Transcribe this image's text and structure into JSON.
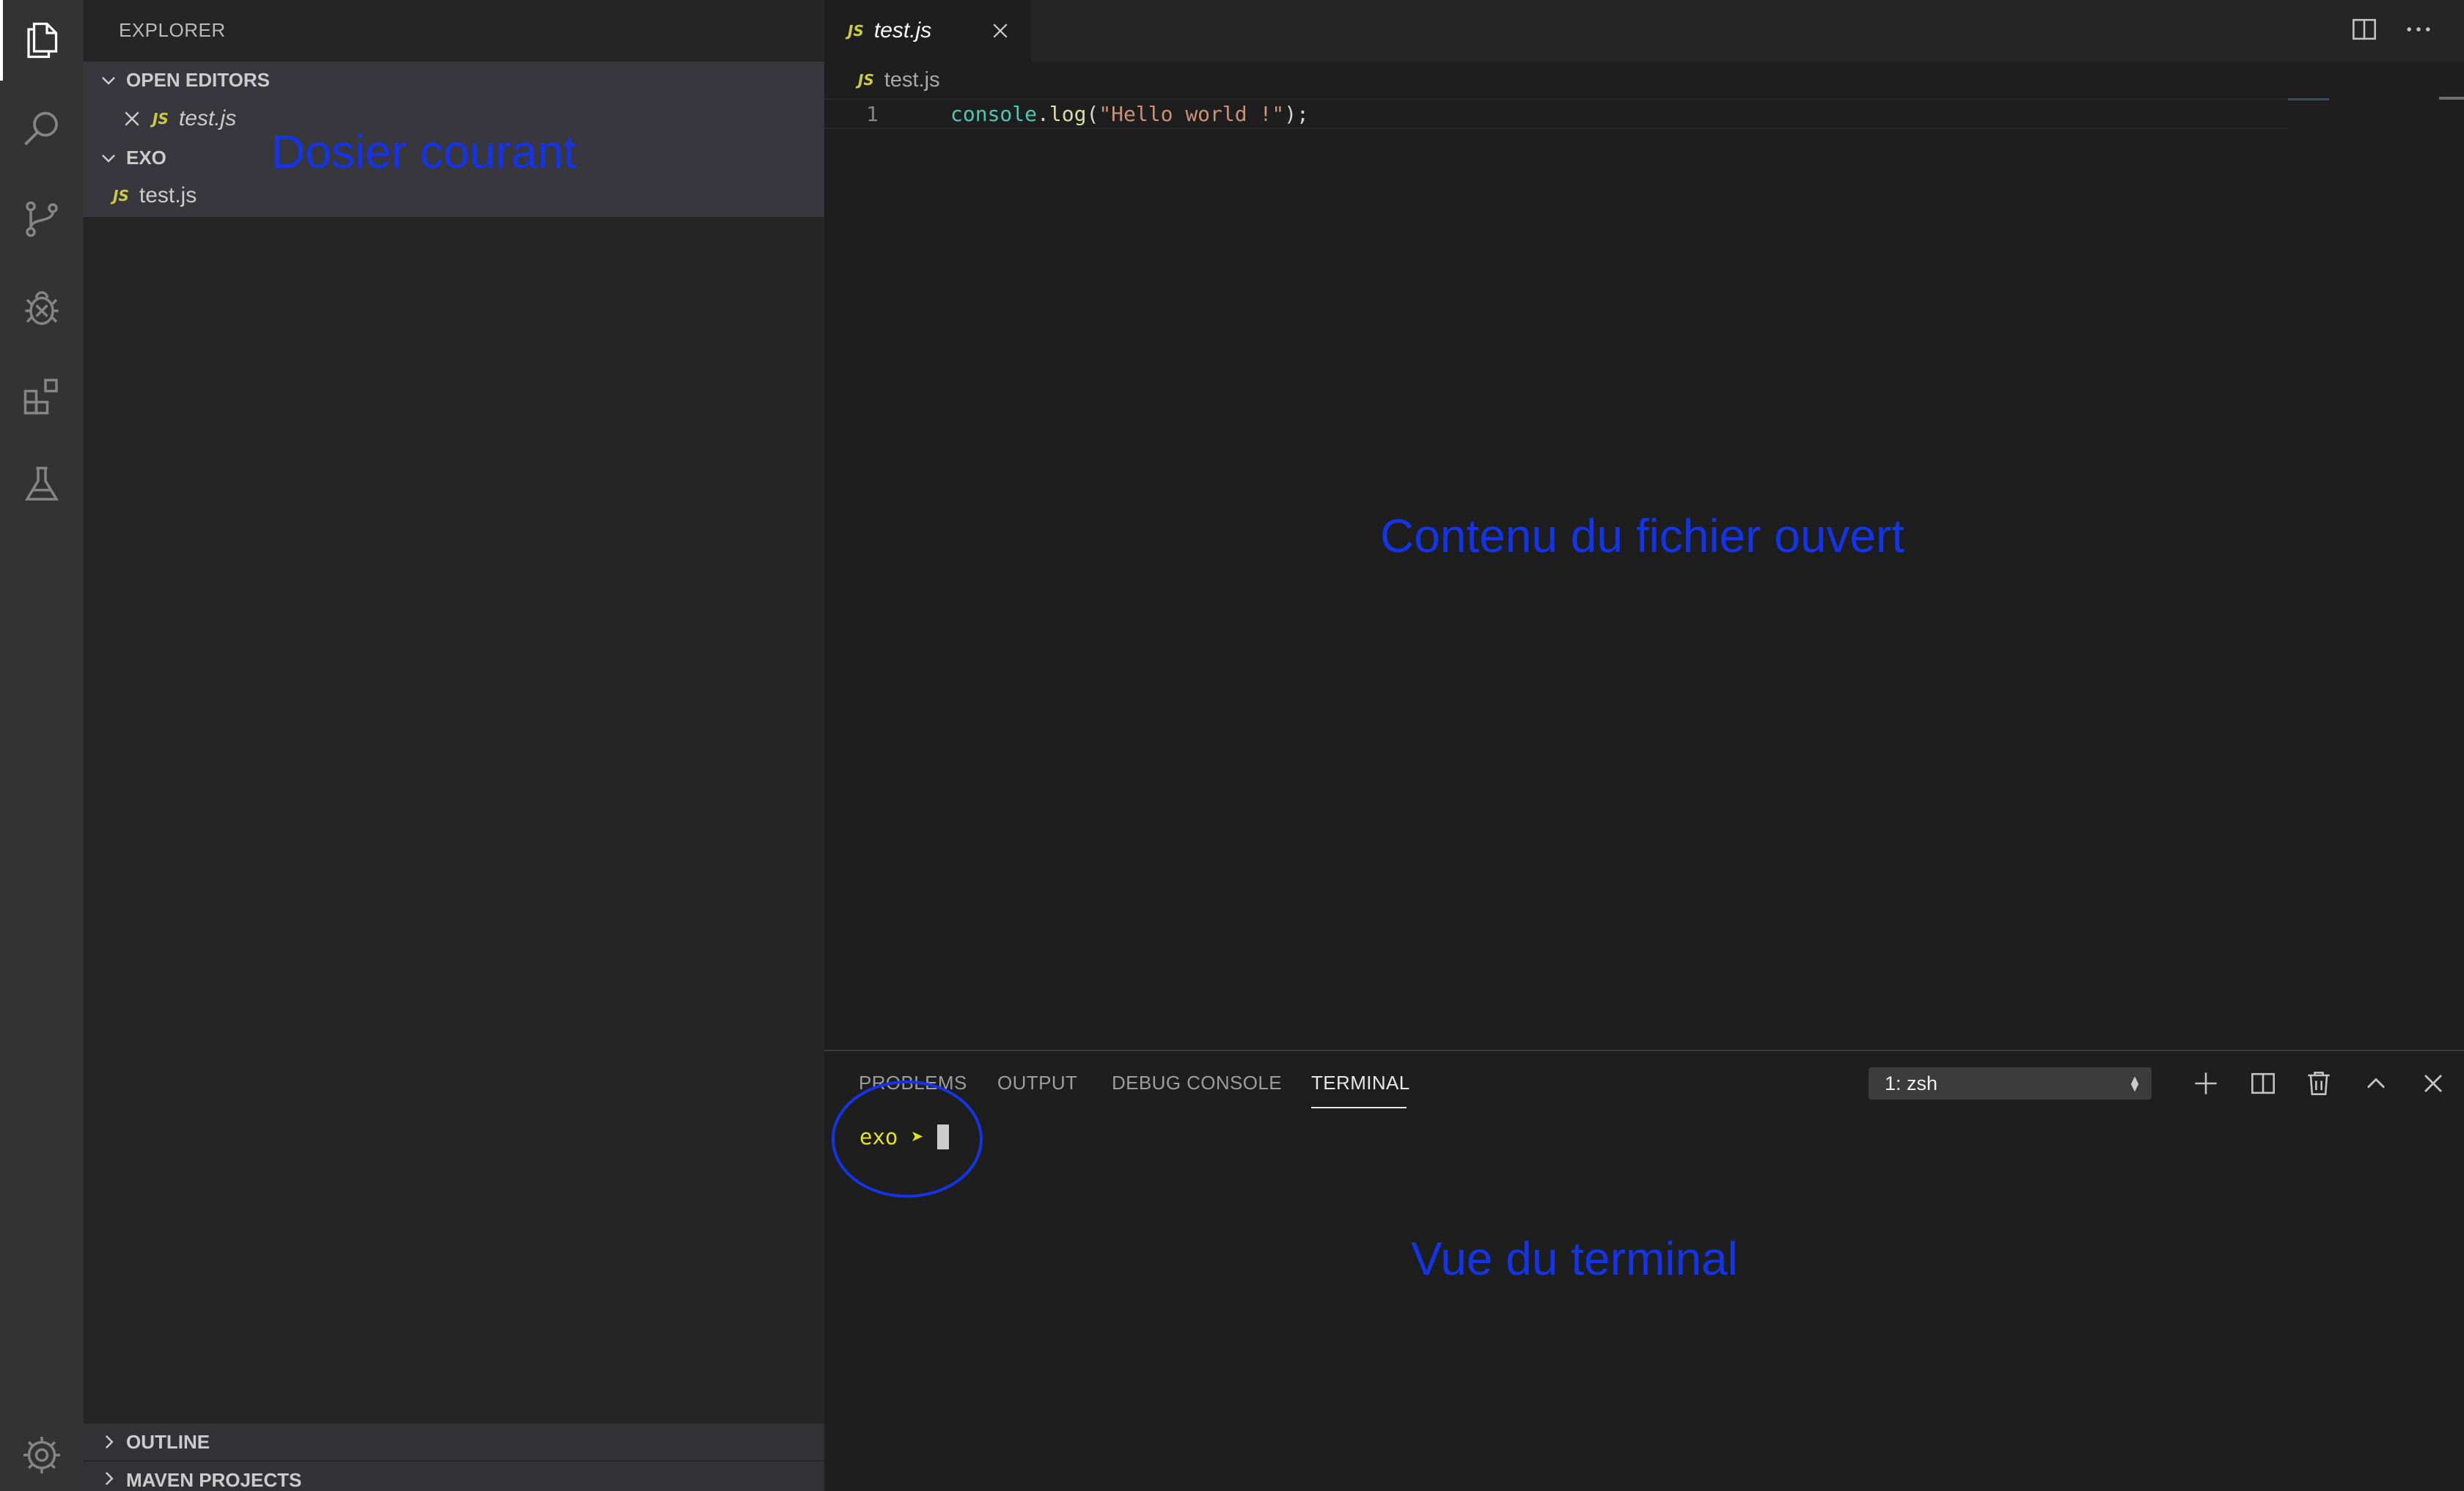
{
  "activity_bar": {
    "items": [
      "explorer-icon",
      "search-icon",
      "source-control-icon",
      "debug-icon",
      "extensions-icon",
      "test-flask-icon"
    ],
    "bottom": "gear-icon"
  },
  "sidebar": {
    "title": "EXPLORER",
    "open_editors": {
      "header": "OPEN EDITORS",
      "files": [
        {
          "badge": "JS",
          "name": "test.js"
        }
      ]
    },
    "folder": {
      "header": "EXO",
      "files": [
        {
          "badge": "JS",
          "name": "test.js"
        }
      ]
    },
    "bottom_sections": [
      "OUTLINE",
      "MAVEN PROJECTS"
    ]
  },
  "editor": {
    "tab": {
      "badge": "JS",
      "name": "test.js"
    },
    "breadcrumb": {
      "badge": "JS",
      "name": "test.js"
    },
    "lines": [
      {
        "number": "1",
        "tokens": {
          "obj": "console",
          "dot": ".",
          "fn": "log",
          "open": "(",
          "str": "\"Hello world !\"",
          "close": ");"
        }
      }
    ]
  },
  "panel": {
    "tabs": [
      "PROBLEMS",
      "OUTPUT",
      "DEBUG CONSOLE",
      "TERMINAL"
    ],
    "active_tab": "TERMINAL",
    "terminal_select": "1: zsh",
    "prompt": {
      "dir": "exo",
      "arrow": "➤"
    }
  },
  "annotations": {
    "sidebar": "Dosier courant",
    "editor": "Contenu du fichier ouvert",
    "terminal": "Vue du terminal"
  },
  "colors": {
    "annotation": "#1434e8",
    "js_badge": "#cbcb41",
    "prompt": "#e5e510"
  }
}
